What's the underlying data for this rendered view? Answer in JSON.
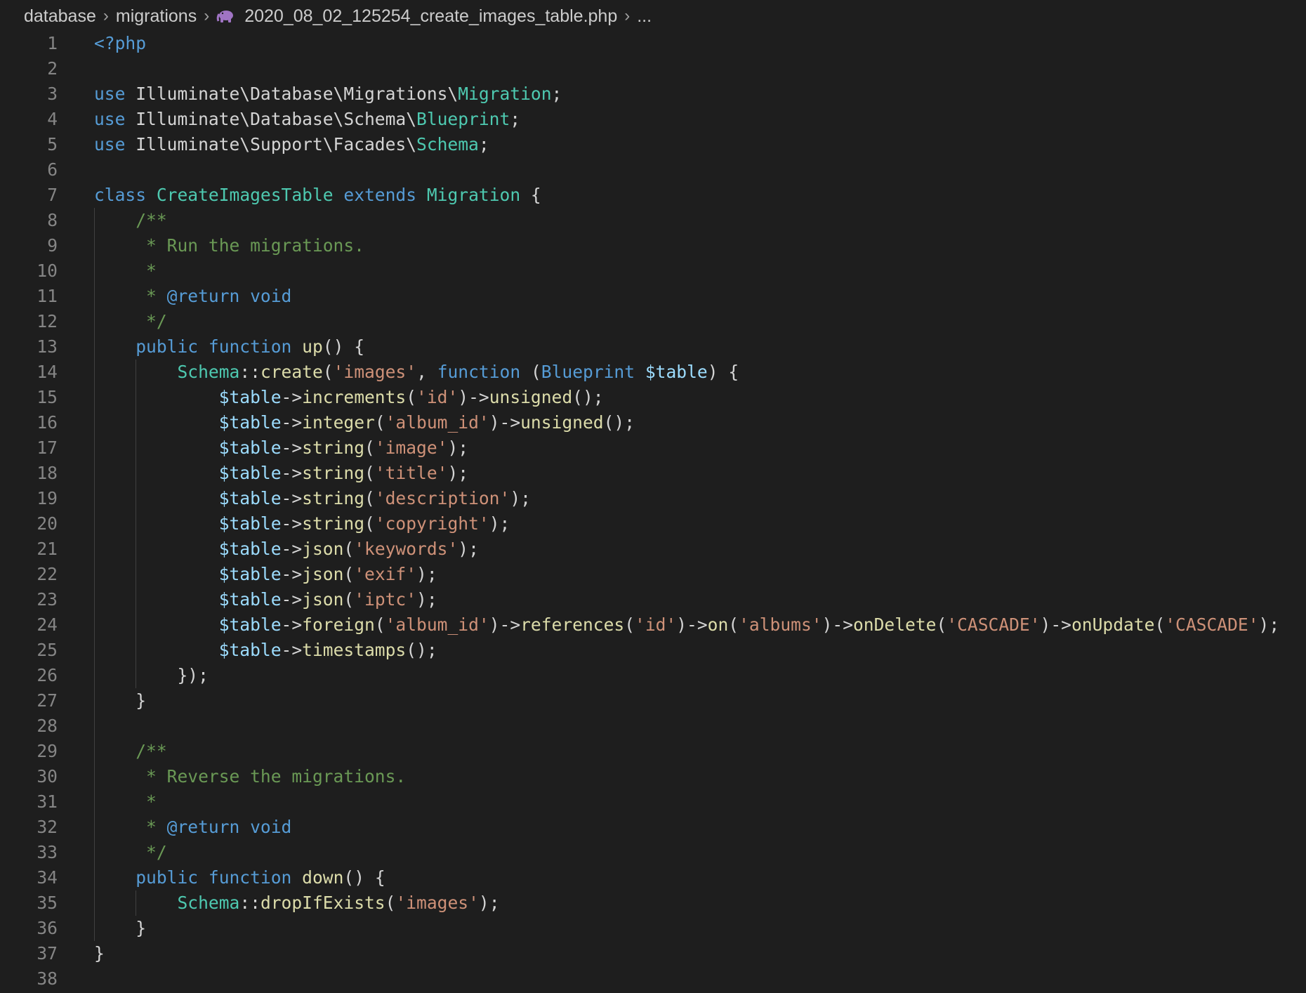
{
  "breadcrumb": {
    "items": [
      "database",
      "migrations",
      "2020_08_02_125254_create_images_table.php",
      "..."
    ],
    "file_icon": "php-elephant-icon"
  },
  "colors": {
    "background": "#1e1e1e",
    "line_number": "#858585",
    "keyword": "#569cd6",
    "class": "#4ec9b0",
    "function": "#dcdcaa",
    "variable": "#9cdcfe",
    "string": "#ce9178",
    "comment": "#6a9955",
    "text": "#d4d4d4"
  },
  "code": {
    "lines": [
      [
        [
          "kw",
          "<?php"
        ]
      ],
      [],
      [
        [
          "kw",
          "use"
        ],
        [
          "txt",
          " Illuminate\\Database\\Migrations\\"
        ],
        [
          "cls",
          "Migration"
        ],
        [
          "txt",
          ";"
        ]
      ],
      [
        [
          "kw",
          "use"
        ],
        [
          "txt",
          " Illuminate\\Database\\Schema\\"
        ],
        [
          "cls",
          "Blueprint"
        ],
        [
          "txt",
          ";"
        ]
      ],
      [
        [
          "kw",
          "use"
        ],
        [
          "txt",
          " Illuminate\\Support\\Facades\\"
        ],
        [
          "cls",
          "Schema"
        ],
        [
          "txt",
          ";"
        ]
      ],
      [],
      [
        [
          "kw",
          "class"
        ],
        [
          "txt",
          " "
        ],
        [
          "cls",
          "CreateImagesTable"
        ],
        [
          "txt",
          " "
        ],
        [
          "kw",
          "extends"
        ],
        [
          "txt",
          " "
        ],
        [
          "cls",
          "Migration"
        ],
        [
          "txt",
          " {"
        ]
      ],
      [
        [
          "txt",
          "    "
        ],
        [
          "cmt",
          "/**"
        ]
      ],
      [
        [
          "txt",
          "    "
        ],
        [
          "cmt",
          " * Run the migrations."
        ]
      ],
      [
        [
          "txt",
          "    "
        ],
        [
          "cmt",
          " *"
        ]
      ],
      [
        [
          "txt",
          "    "
        ],
        [
          "cmt",
          " * "
        ],
        [
          "doc",
          "@return"
        ],
        [
          "txt",
          " "
        ],
        [
          "doc",
          "void"
        ]
      ],
      [
        [
          "txt",
          "    "
        ],
        [
          "cmt",
          " */"
        ]
      ],
      [
        [
          "txt",
          "    "
        ],
        [
          "kw",
          "public"
        ],
        [
          "txt",
          " "
        ],
        [
          "kw",
          "function"
        ],
        [
          "txt",
          " "
        ],
        [
          "fn",
          "up"
        ],
        [
          "txt",
          "() {"
        ]
      ],
      [
        [
          "txt",
          "        "
        ],
        [
          "cls",
          "Schema"
        ],
        [
          "txt",
          "::"
        ],
        [
          "fn",
          "create"
        ],
        [
          "txt",
          "("
        ],
        [
          "str",
          "'images'"
        ],
        [
          "txt",
          ", "
        ],
        [
          "kw",
          "function"
        ],
        [
          "txt",
          " ("
        ],
        [
          "kw",
          "Blueprint"
        ],
        [
          "txt",
          " "
        ],
        [
          "var",
          "$table"
        ],
        [
          "txt",
          ") {"
        ]
      ],
      [
        [
          "txt",
          "            "
        ],
        [
          "var",
          "$table"
        ],
        [
          "txt",
          "->"
        ],
        [
          "fn",
          "increments"
        ],
        [
          "txt",
          "("
        ],
        [
          "str",
          "'id'"
        ],
        [
          "txt",
          ")->"
        ],
        [
          "fn",
          "unsigned"
        ],
        [
          "txt",
          "();"
        ]
      ],
      [
        [
          "txt",
          "            "
        ],
        [
          "var",
          "$table"
        ],
        [
          "txt",
          "->"
        ],
        [
          "fn",
          "integer"
        ],
        [
          "txt",
          "("
        ],
        [
          "str",
          "'album_id'"
        ],
        [
          "txt",
          ")->"
        ],
        [
          "fn",
          "unsigned"
        ],
        [
          "txt",
          "();"
        ]
      ],
      [
        [
          "txt",
          "            "
        ],
        [
          "var",
          "$table"
        ],
        [
          "txt",
          "->"
        ],
        [
          "fn",
          "string"
        ],
        [
          "txt",
          "("
        ],
        [
          "str",
          "'image'"
        ],
        [
          "txt",
          ");"
        ]
      ],
      [
        [
          "txt",
          "            "
        ],
        [
          "var",
          "$table"
        ],
        [
          "txt",
          "->"
        ],
        [
          "fn",
          "string"
        ],
        [
          "txt",
          "("
        ],
        [
          "str",
          "'title'"
        ],
        [
          "txt",
          ");"
        ]
      ],
      [
        [
          "txt",
          "            "
        ],
        [
          "var",
          "$table"
        ],
        [
          "txt",
          "->"
        ],
        [
          "fn",
          "string"
        ],
        [
          "txt",
          "("
        ],
        [
          "str",
          "'description'"
        ],
        [
          "txt",
          ");"
        ]
      ],
      [
        [
          "txt",
          "            "
        ],
        [
          "var",
          "$table"
        ],
        [
          "txt",
          "->"
        ],
        [
          "fn",
          "string"
        ],
        [
          "txt",
          "("
        ],
        [
          "str",
          "'copyright'"
        ],
        [
          "txt",
          ");"
        ]
      ],
      [
        [
          "txt",
          "            "
        ],
        [
          "var",
          "$table"
        ],
        [
          "txt",
          "->"
        ],
        [
          "fn",
          "json"
        ],
        [
          "txt",
          "("
        ],
        [
          "str",
          "'keywords'"
        ],
        [
          "txt",
          ");"
        ]
      ],
      [
        [
          "txt",
          "            "
        ],
        [
          "var",
          "$table"
        ],
        [
          "txt",
          "->"
        ],
        [
          "fn",
          "json"
        ],
        [
          "txt",
          "("
        ],
        [
          "str",
          "'exif'"
        ],
        [
          "txt",
          ");"
        ]
      ],
      [
        [
          "txt",
          "            "
        ],
        [
          "var",
          "$table"
        ],
        [
          "txt",
          "->"
        ],
        [
          "fn",
          "json"
        ],
        [
          "txt",
          "("
        ],
        [
          "str",
          "'iptc'"
        ],
        [
          "txt",
          ");"
        ]
      ],
      [
        [
          "txt",
          "            "
        ],
        [
          "var",
          "$table"
        ],
        [
          "txt",
          "->"
        ],
        [
          "fn",
          "foreign"
        ],
        [
          "txt",
          "("
        ],
        [
          "str",
          "'album_id'"
        ],
        [
          "txt",
          ")->"
        ],
        [
          "fn",
          "references"
        ],
        [
          "txt",
          "("
        ],
        [
          "str",
          "'id'"
        ],
        [
          "txt",
          ")->"
        ],
        [
          "fn",
          "on"
        ],
        [
          "txt",
          "("
        ],
        [
          "str",
          "'albums'"
        ],
        [
          "txt",
          ")->"
        ],
        [
          "fn",
          "onDelete"
        ],
        [
          "txt",
          "("
        ],
        [
          "str",
          "'CASCADE'"
        ],
        [
          "txt",
          ")->"
        ],
        [
          "fn",
          "onUpdate"
        ],
        [
          "txt",
          "("
        ],
        [
          "str",
          "'CASCADE'"
        ],
        [
          "txt",
          ");"
        ]
      ],
      [
        [
          "txt",
          "            "
        ],
        [
          "var",
          "$table"
        ],
        [
          "txt",
          "->"
        ],
        [
          "fn",
          "timestamps"
        ],
        [
          "txt",
          "();"
        ]
      ],
      [
        [
          "txt",
          "        });"
        ]
      ],
      [
        [
          "txt",
          "    }"
        ]
      ],
      [],
      [
        [
          "txt",
          "    "
        ],
        [
          "cmt",
          "/**"
        ]
      ],
      [
        [
          "txt",
          "    "
        ],
        [
          "cmt",
          " * Reverse the migrations."
        ]
      ],
      [
        [
          "txt",
          "    "
        ],
        [
          "cmt",
          " *"
        ]
      ],
      [
        [
          "txt",
          "    "
        ],
        [
          "cmt",
          " * "
        ],
        [
          "doc",
          "@return"
        ],
        [
          "txt",
          " "
        ],
        [
          "doc",
          "void"
        ]
      ],
      [
        [
          "txt",
          "    "
        ],
        [
          "cmt",
          " */"
        ]
      ],
      [
        [
          "txt",
          "    "
        ],
        [
          "kw",
          "public"
        ],
        [
          "txt",
          " "
        ],
        [
          "kw",
          "function"
        ],
        [
          "txt",
          " "
        ],
        [
          "fn",
          "down"
        ],
        [
          "txt",
          "() {"
        ]
      ],
      [
        [
          "txt",
          "        "
        ],
        [
          "cls",
          "Schema"
        ],
        [
          "txt",
          "::"
        ],
        [
          "fn",
          "dropIfExists"
        ],
        [
          "txt",
          "("
        ],
        [
          "str",
          "'images'"
        ],
        [
          "txt",
          ");"
        ]
      ],
      [
        [
          "txt",
          "    }"
        ]
      ],
      [
        [
          "txt",
          "}"
        ]
      ],
      []
    ]
  }
}
